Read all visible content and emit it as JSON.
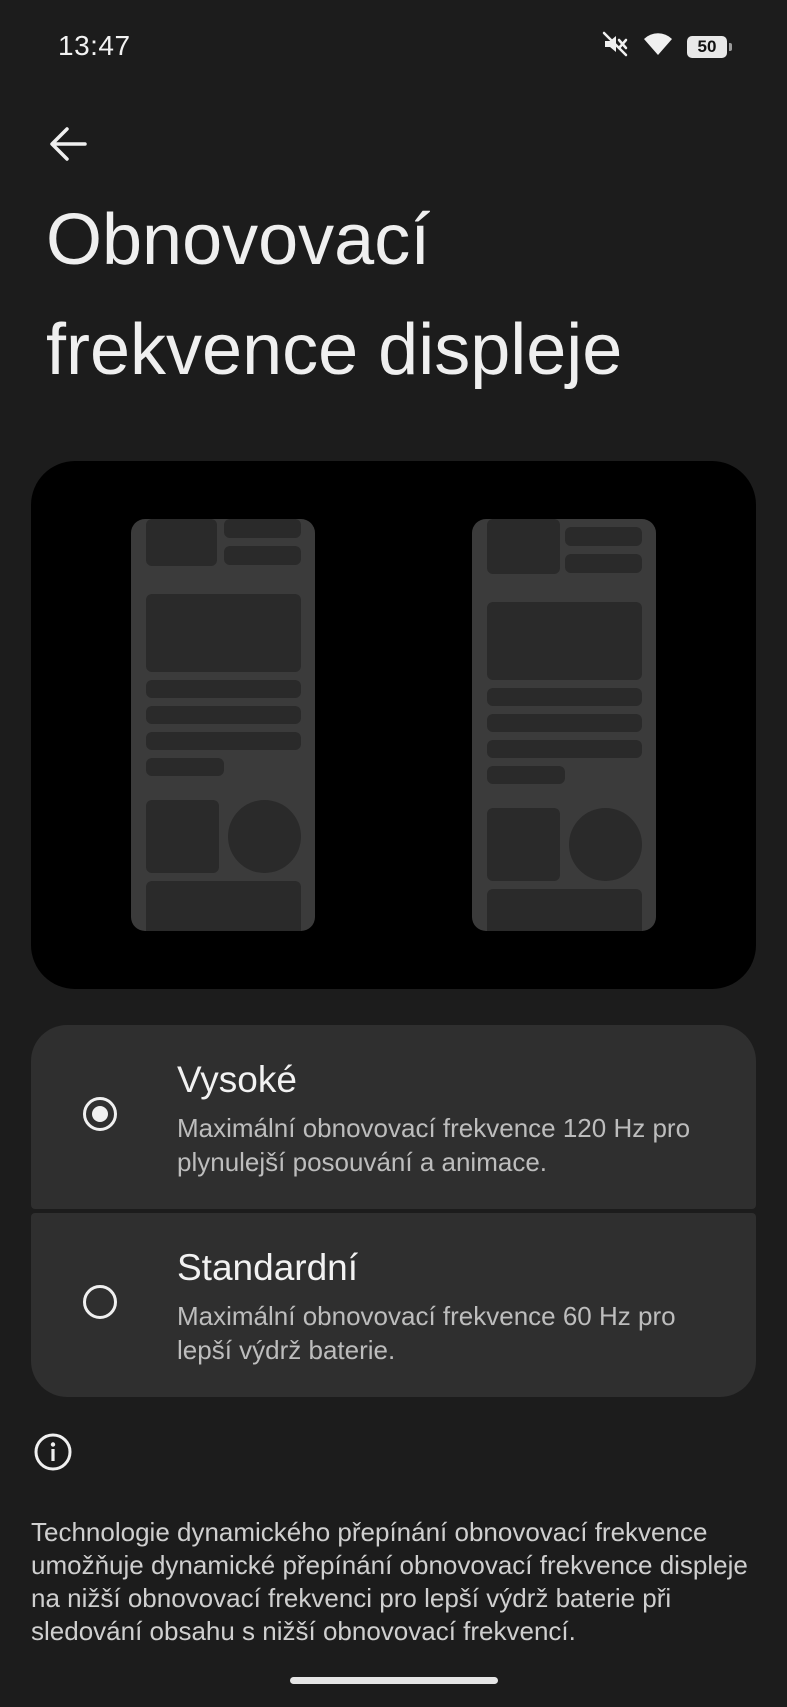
{
  "status_bar": {
    "time": "13:47",
    "battery": "50"
  },
  "page_title": "Obnovovací frekvence displeje",
  "options": [
    {
      "title": "Vysoké",
      "description": "Maximální obnovovací frekvence 120 Hz pro plynulejší posouvání a animace.",
      "selected": true
    },
    {
      "title": "Standardní",
      "description": "Maximální obnovovací frekvence 60 Hz pro lepší výdrž baterie.",
      "selected": false
    }
  ],
  "info_text": "Technologie dynamického přepínání obnovovací frekvence umožňuje dynamické přepínání obnovovací frekvence displeje na nižší obnovovací frekvenci pro lepší výdrž baterie při sledování obsahu s nižší obnovovací frekvencí.",
  "icons": {
    "back": "arrow-left-icon",
    "mute": "mute-icon",
    "wifi": "wifi-icon",
    "battery": "battery-icon",
    "info": "info-icon"
  },
  "colors": {
    "background": "#1c1c1c",
    "preview_bg": "#000000",
    "card": "#2f2f2f",
    "phone_mock": "#3b3b3b",
    "phone_block": "#2a2a2a"
  }
}
